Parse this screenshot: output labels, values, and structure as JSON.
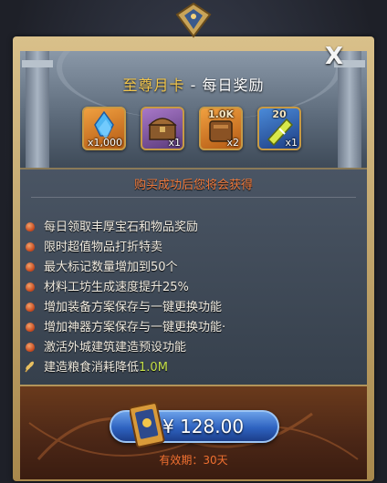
{
  "header": {
    "title_highlight": "至尊月卡",
    "title_sep": " - ",
    "title_rest": "每日奖励",
    "close_label": "X"
  },
  "rewards": [
    {
      "icon": "blue-gem-icon",
      "quantity": "x1,000"
    },
    {
      "icon": "treasure-chest-icon",
      "quantity": "x1"
    },
    {
      "icon": "resource-pack-icon",
      "top_label": "1.0K",
      "quantity": "x2"
    },
    {
      "icon": "speedup-ticket-icon",
      "top_label": "20",
      "quantity": "x1"
    }
  ],
  "panel": {
    "subtitle": "购买成功后您将会获得",
    "benefits": [
      {
        "text": "每日领取丰厚宝石和物品奖励"
      },
      {
        "text": "限时超值物品打折特卖"
      },
      {
        "text": "最大标记数量增加到50个"
      },
      {
        "text": "材料工坊生成速度提升25%"
      },
      {
        "text": "增加装备方案保存与一键更换功能"
      },
      {
        "text": "增加神器方案保存与一键更换功能·"
      },
      {
        "text": "激活外城建筑建造预设功能"
      },
      {
        "text": "建造粮食消耗降低",
        "highlight": "1.0M"
      }
    ]
  },
  "purchase": {
    "price": "¥ 128.00",
    "validity": "有效期：30天"
  },
  "colors": {
    "accent_gold": "#f3c64a",
    "subtitle_orange": "#f07a3c",
    "highlight_green": "#c6e24a",
    "button_blue": "#2e62c0"
  }
}
